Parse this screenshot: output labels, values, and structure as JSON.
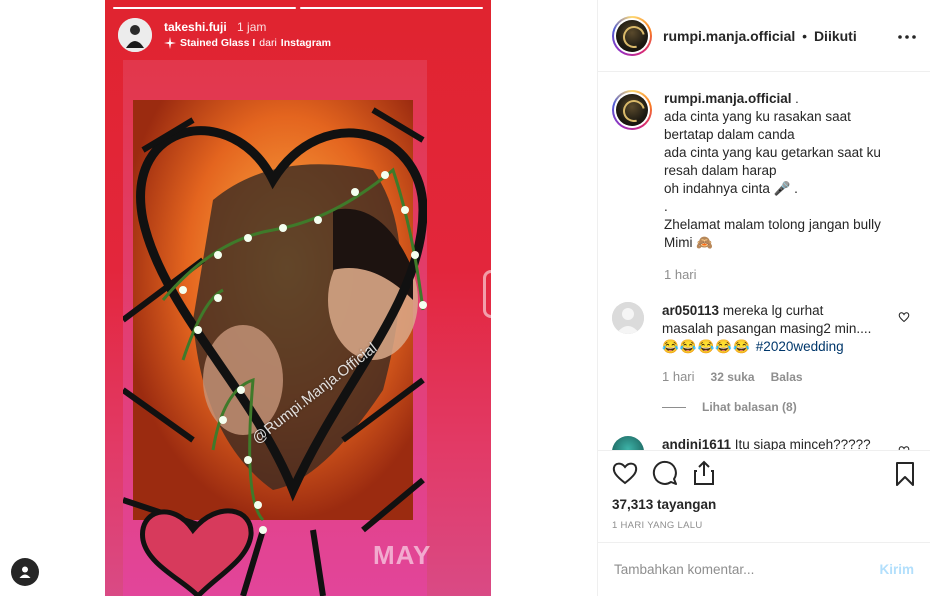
{
  "story": {
    "username": "takeshi.fuji",
    "time": "1 jam",
    "effect": "Stained Glass I",
    "source_prefix": "dari",
    "source": "Instagram",
    "watermark": "@Rumpi.Manja.Official",
    "bottom_text": "MAY"
  },
  "header": {
    "username": "rumpi.manja.official",
    "separator": "•",
    "follow_status": "Diikuti",
    "more_icon": "more-horizontal-icon"
  },
  "caption": {
    "username": "rumpi.manja.official",
    "username_suffix": " .",
    "lines": [
      "ada cinta yang ku rasakan saat",
      "bertatap dalam canda",
      "ada cinta yang kau getarkan saat ku",
      "resah dalam harap",
      "oh indahnya cinta 🎤 .",
      ".",
      "Zhelamat malam tolong jangan bully",
      "Mimi 🙈"
    ],
    "time": "1 hari"
  },
  "comments": [
    {
      "username": "ar050113",
      "text_line1": " mereka lg curhat",
      "text_line2": "masalah pasangan masing2 min....",
      "emojis": "😂😂😂😂😂 ",
      "hashtag": "#2020wedding",
      "time": "1 hari",
      "likes": "32 suka",
      "reply": "Balas",
      "view_replies": "Lihat balasan (8)"
    },
    {
      "username": "andini1611",
      "text": " Itu siapa minceh?????"
    }
  ],
  "actions": {
    "views": "37,313 tayangan",
    "posted": "1 HARI YANG LALU"
  },
  "comment_box": {
    "placeholder": "Tambahkan komentar...",
    "send": "Kirim"
  },
  "colors": {
    "story_bg": "#e0242f",
    "link": "#00376b",
    "muted": "#8e8e8e",
    "send_disabled": "#b2dffc"
  }
}
